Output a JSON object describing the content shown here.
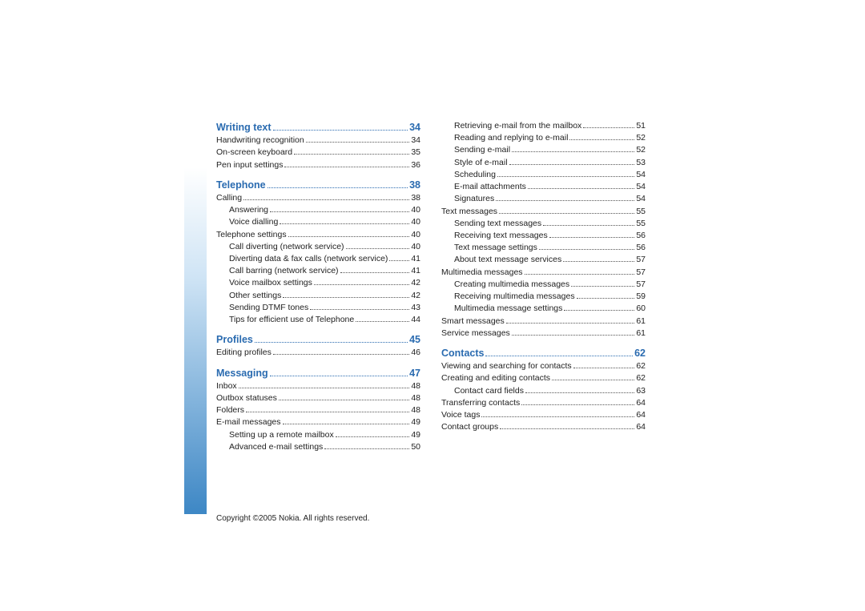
{
  "copyright": "Copyright ©2005 Nokia. All rights reserved.",
  "col1": [
    {
      "lvl": 0,
      "label": "Writing text",
      "pg": "34"
    },
    {
      "lvl": 1,
      "label": "Handwriting recognition",
      "pg": "34"
    },
    {
      "lvl": 1,
      "label": "On-screen keyboard",
      "pg": "35"
    },
    {
      "lvl": 1,
      "label": "Pen input settings",
      "pg": "36"
    },
    {
      "lvl": 0,
      "label": "Telephone",
      "pg": "38"
    },
    {
      "lvl": 1,
      "label": "Calling",
      "pg": "38"
    },
    {
      "lvl": 2,
      "label": "Answering",
      "pg": "40"
    },
    {
      "lvl": 2,
      "label": "Voice dialling",
      "pg": "40"
    },
    {
      "lvl": 1,
      "label": "Telephone settings",
      "pg": "40"
    },
    {
      "lvl": 2,
      "label": "Call diverting (network service)",
      "pg": "40"
    },
    {
      "lvl": 2,
      "label": "Diverting data & fax calls (network service)",
      "pg": "41"
    },
    {
      "lvl": 2,
      "label": "Call barring (network service)",
      "pg": "41"
    },
    {
      "lvl": 2,
      "label": "Voice mailbox settings",
      "pg": "42"
    },
    {
      "lvl": 2,
      "label": "Other settings",
      "pg": "42"
    },
    {
      "lvl": 2,
      "label": "Sending DTMF tones",
      "pg": "43"
    },
    {
      "lvl": 2,
      "label": "Tips for efficient use of Telephone",
      "pg": "44"
    },
    {
      "lvl": 0,
      "label": "Profiles",
      "pg": "45"
    },
    {
      "lvl": 1,
      "label": "Editing profiles",
      "pg": "46"
    },
    {
      "lvl": 0,
      "label": "Messaging",
      "pg": "47"
    },
    {
      "lvl": 1,
      "label": "Inbox",
      "pg": "48"
    },
    {
      "lvl": 1,
      "label": "Outbox statuses",
      "pg": "48"
    },
    {
      "lvl": 1,
      "label": "Folders",
      "pg": "48"
    },
    {
      "lvl": 1,
      "label": "E-mail messages",
      "pg": "49"
    },
    {
      "lvl": 2,
      "label": "Setting up a remote mailbox",
      "pg": "49"
    },
    {
      "lvl": 2,
      "label": "Advanced e-mail settings",
      "pg": "50"
    }
  ],
  "col2": [
    {
      "lvl": 2,
      "label": "Retrieving e-mail from the mailbox",
      "pg": "51"
    },
    {
      "lvl": 2,
      "label": "Reading and replying to e-mail",
      "pg": "52"
    },
    {
      "lvl": 2,
      "label": "Sending e-mail",
      "pg": "52"
    },
    {
      "lvl": 2,
      "label": "Style of e-mail",
      "pg": "53"
    },
    {
      "lvl": 2,
      "label": "Scheduling",
      "pg": "54"
    },
    {
      "lvl": 2,
      "label": "E-mail attachments",
      "pg": "54"
    },
    {
      "lvl": 2,
      "label": "Signatures",
      "pg": "54"
    },
    {
      "lvl": 1,
      "label": "Text messages",
      "pg": "55"
    },
    {
      "lvl": 2,
      "label": "Sending text messages",
      "pg": "55"
    },
    {
      "lvl": 2,
      "label": "Receiving text messages",
      "pg": "56"
    },
    {
      "lvl": 2,
      "label": "Text message settings",
      "pg": "56"
    },
    {
      "lvl": 2,
      "label": "About text message services",
      "pg": "57"
    },
    {
      "lvl": 1,
      "label": "Multimedia messages",
      "pg": "57"
    },
    {
      "lvl": 2,
      "label": "Creating multimedia messages",
      "pg": "57"
    },
    {
      "lvl": 2,
      "label": "Receiving multimedia messages",
      "pg": "59"
    },
    {
      "lvl": 2,
      "label": "Multimedia message settings",
      "pg": "60"
    },
    {
      "lvl": 1,
      "label": "Smart messages",
      "pg": "61"
    },
    {
      "lvl": 1,
      "label": "Service messages",
      "pg": "61"
    },
    {
      "lvl": 0,
      "label": "Contacts",
      "pg": "62"
    },
    {
      "lvl": 1,
      "label": "Viewing and searching for contacts",
      "pg": "62"
    },
    {
      "lvl": 1,
      "label": "Creating and editing contacts",
      "pg": "62"
    },
    {
      "lvl": 2,
      "label": "Contact card fields",
      "pg": "63"
    },
    {
      "lvl": 1,
      "label": "Transferring contacts",
      "pg": "64"
    },
    {
      "lvl": 1,
      "label": "Voice tags",
      "pg": "64"
    },
    {
      "lvl": 1,
      "label": "Contact groups",
      "pg": "64"
    }
  ]
}
